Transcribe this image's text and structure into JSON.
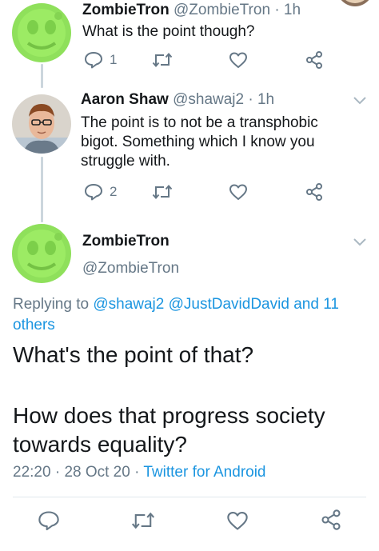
{
  "tweets": [
    {
      "display_name": "ZombieTron",
      "handle": "@ZombieTron",
      "time": "1h",
      "text": "What is the point though?",
      "reply_count": "1"
    },
    {
      "display_name": "Aaron Shaw",
      "handle": "@shawaj2",
      "time": "1h",
      "text": "The point is to not be a transphobic bigot. Something which I know you struggle with.",
      "reply_count": "2"
    }
  ],
  "main_tweet": {
    "display_name": "ZombieTron",
    "handle": "@ZombieTron",
    "replying_prefix": "Replying to",
    "replying_to_1": "@shawaj2",
    "replying_to_2": "@JustDavidDavid",
    "replying_and": "and",
    "replying_others": "11 others",
    "text_line_1": "What's the point of that?",
    "text_line_2": "How does that progress society towards equality?",
    "time": "22:20",
    "date": "28 Oct 20",
    "source": "Twitter for Android"
  },
  "separator": "·",
  "colors": {
    "accent": "#1b95e0",
    "muted": "#657786",
    "text": "#14171a",
    "thread_line": "#ccd6dd"
  }
}
